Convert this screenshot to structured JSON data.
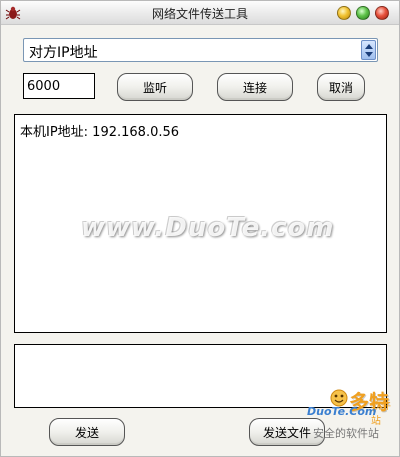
{
  "window": {
    "title": "网络文件传送工具"
  },
  "connection": {
    "ip_combo_value": "对方IP地址",
    "port_value": "6000",
    "listen_label": "监听",
    "connect_label": "连接",
    "cancel_label": "取消"
  },
  "log": {
    "local_ip_text": "本机IP地址: 192.168.0.56"
  },
  "message": {
    "value": ""
  },
  "actions": {
    "send_label": "发送",
    "send_file_label": "发送文件"
  },
  "watermark": {
    "center": "www.DuoTe.com",
    "corner_cn": "多特",
    "corner_sub": "软件站",
    "corner_en": "DuoTe.Com",
    "corner_slogan": "安全的软件站"
  },
  "colors": {
    "window_bg": "#f4f3ee",
    "combo_border": "#7a96b4",
    "watermark_orange": "#f0a020",
    "watermark_blue": "#3a7fd0"
  }
}
